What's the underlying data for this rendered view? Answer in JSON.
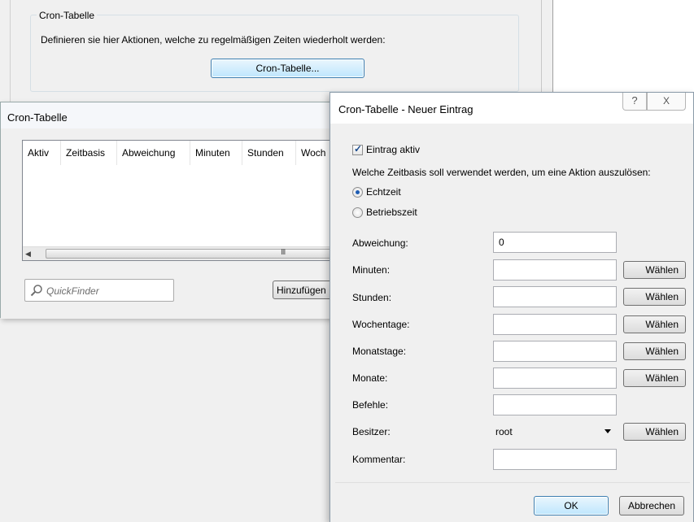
{
  "background": {
    "group_title": "Cron-Tabelle",
    "description": "Definieren sie hier Aktionen, welche zu regelmäßigen Zeiten wiederholt werden:",
    "button_label": "Cron-Tabelle..."
  },
  "list_window": {
    "title": "Cron-Tabelle",
    "columns": [
      "Aktiv",
      "Zeitbasis",
      "Abweichung",
      "Minuten",
      "Stunden",
      "Woch"
    ],
    "scroll_grip": "III",
    "quickfinder_placeholder": "QuickFinder",
    "add_button": "Hinzufügen"
  },
  "dialog": {
    "title": "Cron-Tabelle - Neuer Eintrag",
    "help_glyph": "?",
    "close_glyph": "X",
    "entry_active_label": "Eintrag aktiv",
    "entry_active_checked": true,
    "timebase_question": "Welche Zeitbasis soll verwendet werden, um eine Aktion auszulösen:",
    "timebase_options": [
      {
        "label": "Echtzeit",
        "selected": true
      },
      {
        "label": "Betriebszeit",
        "selected": false
      }
    ],
    "fields": {
      "abweichung": {
        "label": "Abweichung:",
        "value": "0"
      },
      "minuten": {
        "label": "Minuten:",
        "value": ""
      },
      "stunden": {
        "label": "Stunden:",
        "value": ""
      },
      "wochentage": {
        "label": "Wochentage:",
        "value": ""
      },
      "monatstage": {
        "label": "Monatstage:",
        "value": ""
      },
      "monate": {
        "label": "Monate:",
        "value": ""
      },
      "befehle": {
        "label": "Befehle:",
        "value": ""
      },
      "besitzer": {
        "label": "Besitzer:",
        "value": "root"
      },
      "kommentar": {
        "label": "Kommentar:",
        "value": ""
      }
    },
    "choose_label": "Wählen",
    "ok_label": "OK",
    "cancel_label": "Abbrechen"
  },
  "colors": {
    "accent_border": "#3c7fb1",
    "radio_dot": "#1d5cb3"
  }
}
